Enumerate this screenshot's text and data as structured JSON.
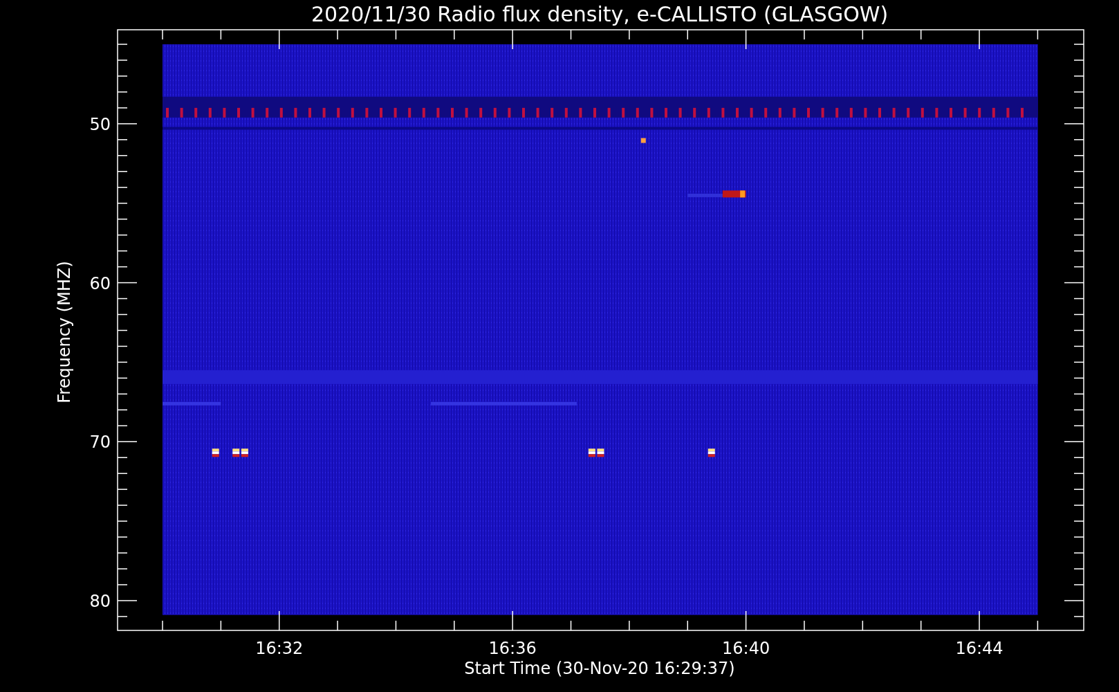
{
  "title": "2020/11/30  Radio flux density, e-CALLISTO (GLASGOW)",
  "plot": {
    "xlabel": "Start Time (30-Nov-20 16:29:37)",
    "ylabel": "Frequency (MHZ)",
    "xticks": [
      "16:32",
      "16:36",
      "16:40",
      "16:44"
    ],
    "yticks": [
      "50",
      "60",
      "70",
      "80"
    ]
  }
}
